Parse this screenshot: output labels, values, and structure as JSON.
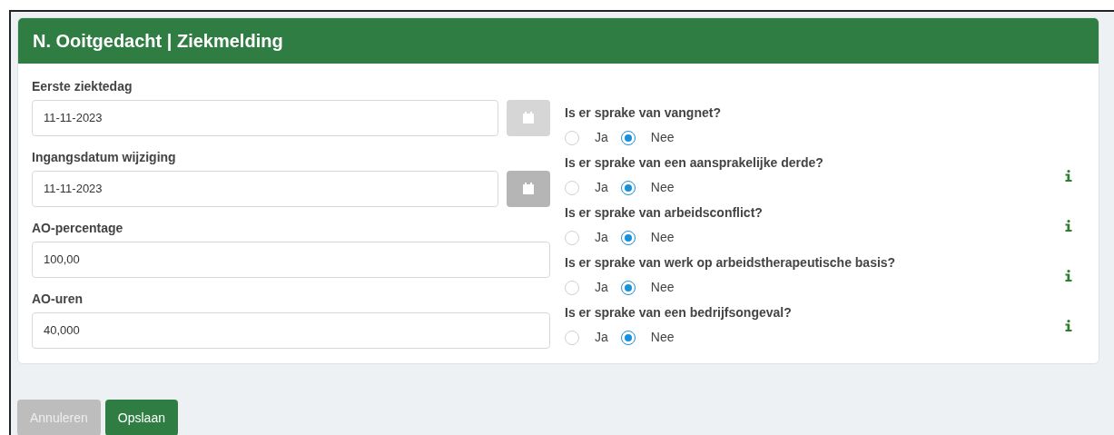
{
  "card": {
    "title": "N. Ooitgedacht | Ziekmelding"
  },
  "fields": [
    {
      "label": "Eerste ziektedag",
      "value": "11-11-2023",
      "kind": "date",
      "calendar_disabled": true
    },
    {
      "label": "Ingangsdatum wijziging",
      "value": "11-11-2023",
      "kind": "date",
      "calendar_disabled": false
    },
    {
      "label": "AO-percentage",
      "value": "100,00",
      "kind": "text"
    },
    {
      "label": "AO-uren",
      "value": "40,000",
      "kind": "text"
    }
  ],
  "questions": [
    {
      "label": "Is er sprake van vangnet?",
      "info": false,
      "options": [
        {
          "label": "Ja",
          "selected": false
        },
        {
          "label": "Nee",
          "selected": true
        }
      ]
    },
    {
      "label": "Is er sprake van een aansprakelijke derde?",
      "info": true,
      "options": [
        {
          "label": "Ja",
          "selected": false
        },
        {
          "label": "Nee",
          "selected": true
        }
      ]
    },
    {
      "label": "Is er sprake van arbeidsconflict?",
      "info": true,
      "options": [
        {
          "label": "Ja",
          "selected": false
        },
        {
          "label": "Nee",
          "selected": true
        }
      ]
    },
    {
      "label": "Is er sprake van werk op arbeidstherapeutische basis?",
      "info": true,
      "options": [
        {
          "label": "Ja",
          "selected": false
        },
        {
          "label": "Nee",
          "selected": true
        }
      ]
    },
    {
      "label": "Is er sprake van een bedrijfsongeval?",
      "info": true,
      "options": [
        {
          "label": "Ja",
          "selected": false
        },
        {
          "label": "Nee",
          "selected": true
        }
      ]
    }
  ],
  "buttons": [
    {
      "label": "Annuleren",
      "disabled": true
    },
    {
      "label": "Opslaan",
      "disabled": false
    }
  ]
}
